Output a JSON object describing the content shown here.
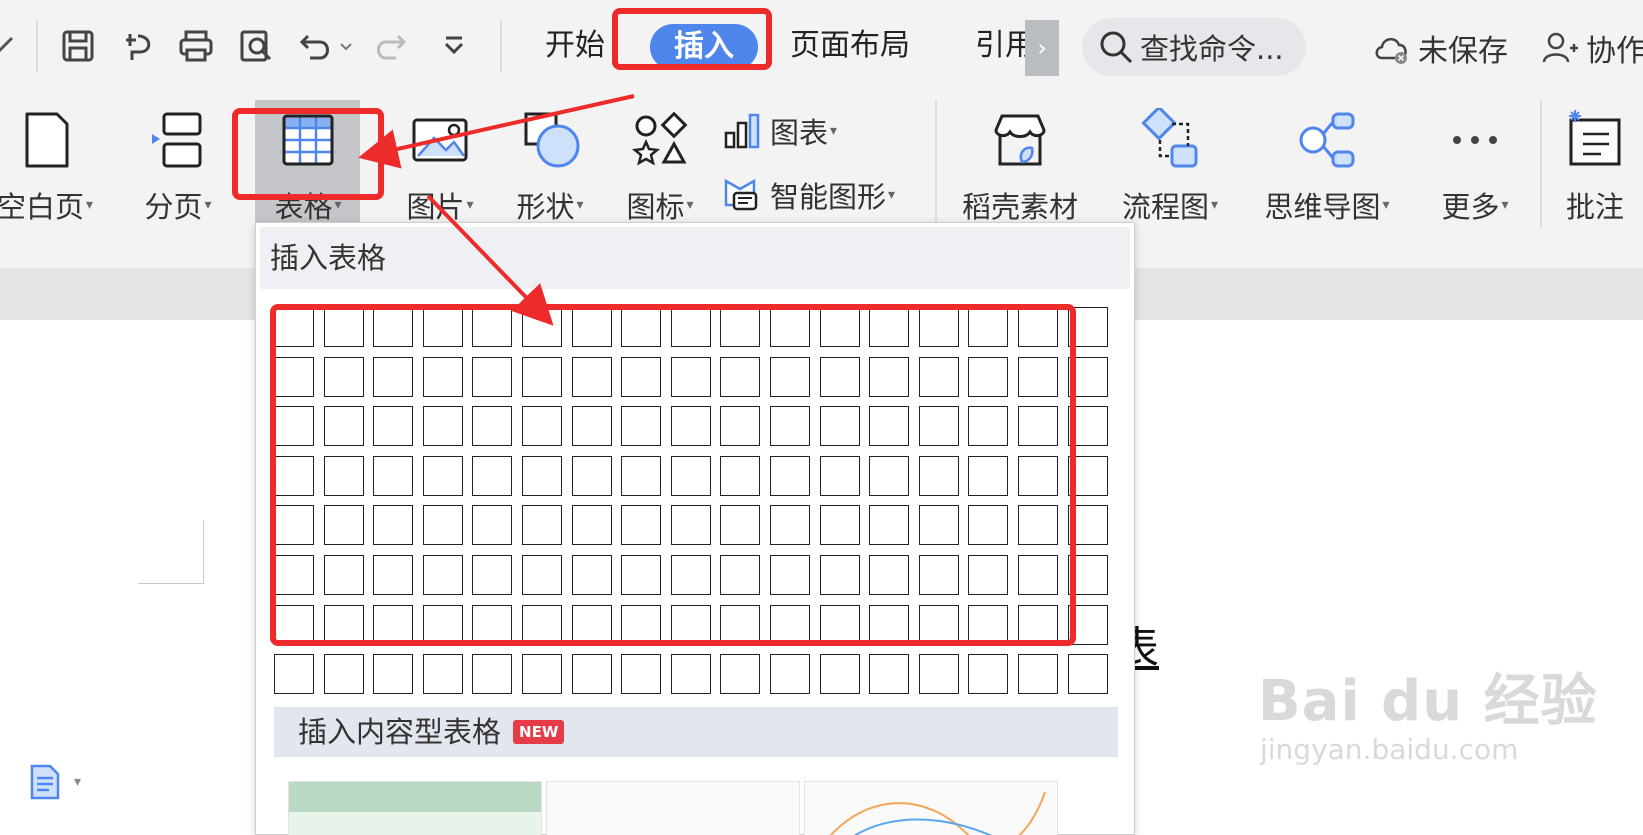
{
  "tabs": [
    {
      "label": "开始",
      "active": false
    },
    {
      "label": "插入",
      "active": true
    },
    {
      "label": "页面布局",
      "active": false
    },
    {
      "label": "引用",
      "active": false
    }
  ],
  "search": {
    "label": "查找命令..."
  },
  "top_right": {
    "unsaved": "未保存",
    "collab": "协作"
  },
  "ribbon": {
    "blank_page": "空白页",
    "page_break": "分页",
    "table": "表格",
    "picture": "图片",
    "shape": "形状",
    "icon": "图标",
    "chart": "图表",
    "smart_art": "智能图形",
    "daoke": "稻壳素材",
    "flowchart": "流程图",
    "mindmap": "思维导图",
    "more": "更多",
    "comment": "批注"
  },
  "dropdown": {
    "title": "插入表格",
    "grid_rows": 8,
    "grid_cols": 17,
    "content_table_label": "插入内容型表格",
    "new_badge": "NEW"
  },
  "document": {
    "title_fragment": "表"
  },
  "watermark": {
    "main": "Bai du 经验",
    "sub": "jingyan.baidu.com"
  },
  "colors": {
    "accent": "#4f86ec",
    "annotation": "#ee2b2b",
    "badge": "#e63c48"
  }
}
